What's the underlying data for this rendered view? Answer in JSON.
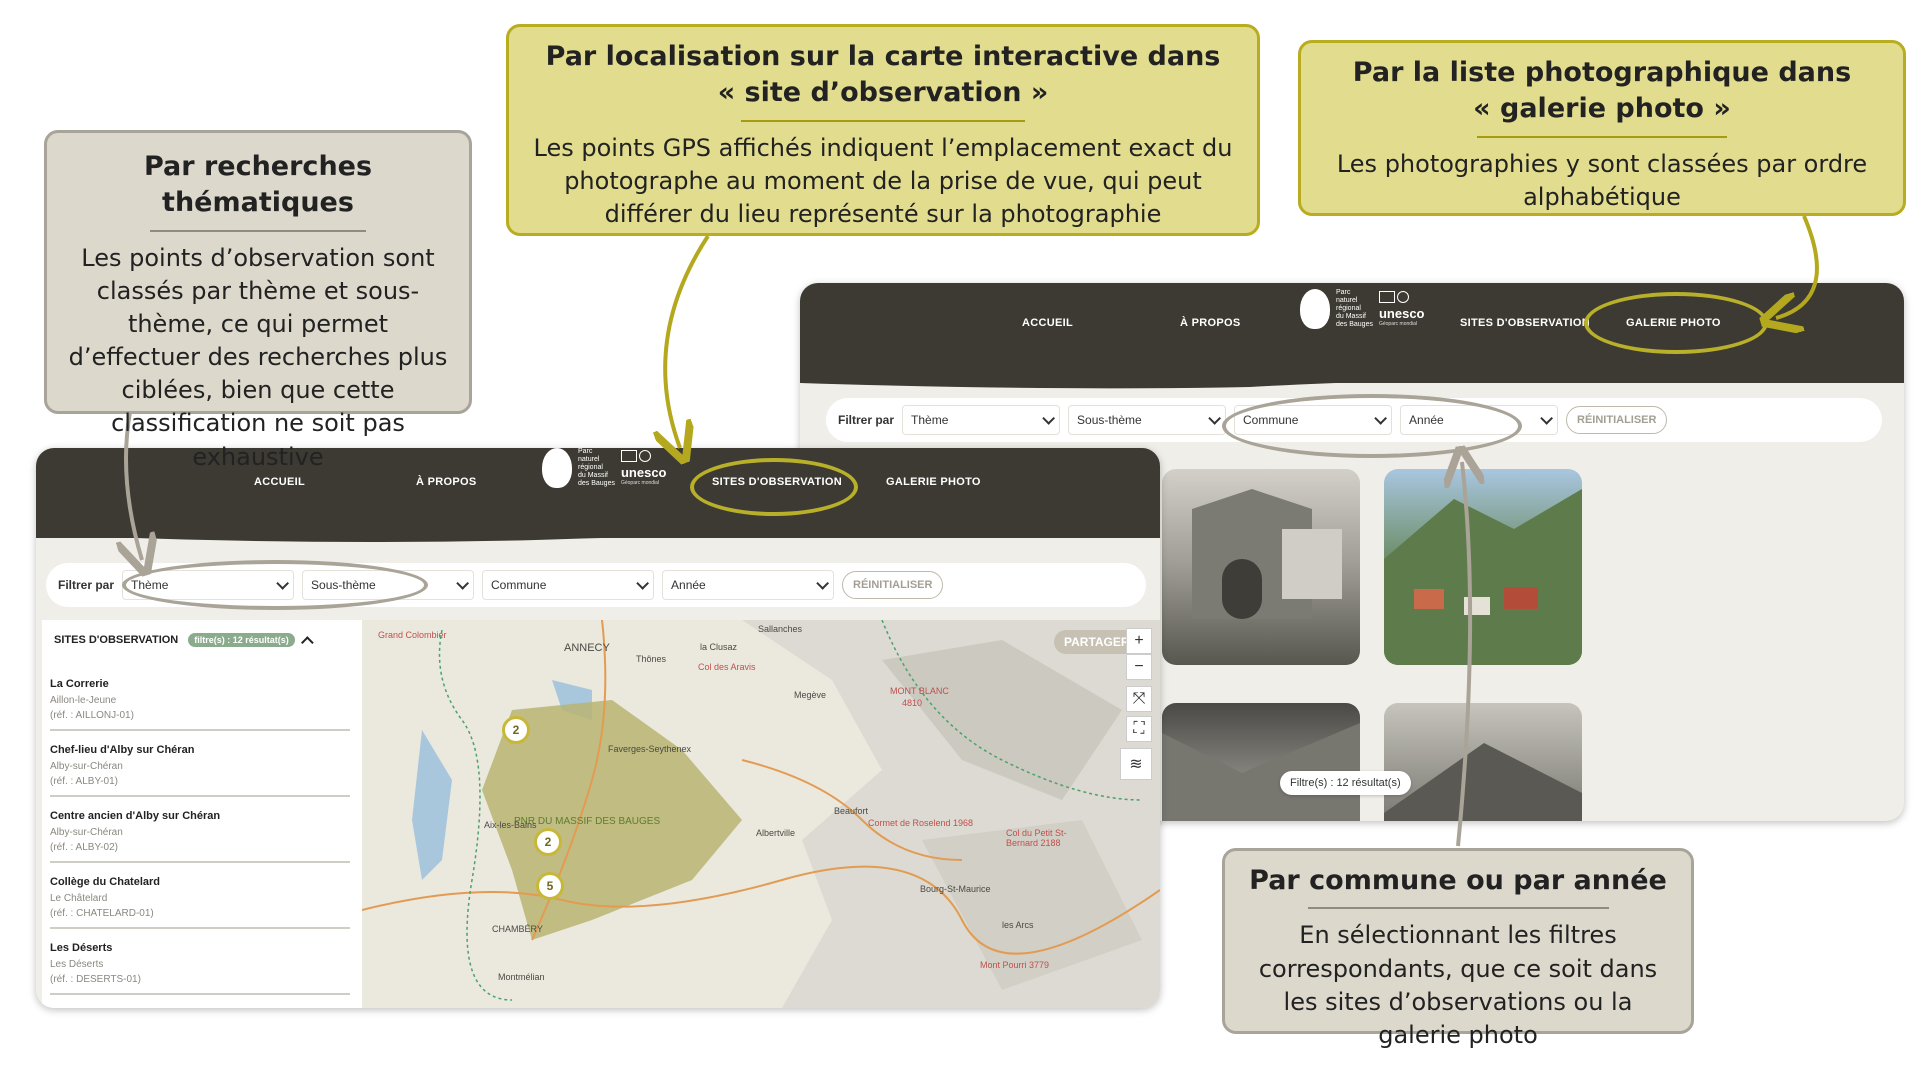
{
  "callouts": {
    "thematic": {
      "title": "Par recherches thématiques",
      "body": "Les points d’observation sont classés par thème et sous-thème, ce qui permet d’effectuer des recherches plus ciblées, bien que cette classification ne soit pas exhaustive"
    },
    "map": {
      "title_line1": "Par localisation sur la carte interactive dans",
      "title_line2": "« site d’observation »",
      "body": "Les points GPS affichés indiquent l’emplacement exact du photographe au moment de la prise de vue, qui peut différer du lieu représenté sur la photographie"
    },
    "gallery": {
      "title_line1": "Par la liste photographique dans",
      "title_line2": "« galerie photo »",
      "body": "Les photographies y sont classées par ordre alphabétique"
    },
    "commune": {
      "title": "Par commune ou par année",
      "body": "En sélectionnant les filtres correspondants, que ce soit dans les sites d’observations ou la galerie photo"
    }
  },
  "nav": {
    "home": "ACCUEIL",
    "about": "À PROPOS",
    "sites": "SITES D'OBSERVATION",
    "gallery": "GALERIE PHOTO"
  },
  "logo": {
    "park_lines": [
      "Parc",
      "naturel",
      "régional",
      "du Massif",
      "des Bauges"
    ],
    "unesco": "unesco",
    "geopark": "Géoparc mondial"
  },
  "filters_map": {
    "label": "Filtrer par",
    "theme": "Thème",
    "subtheme": "Sous-thème",
    "commune": "Commune",
    "year": "Année",
    "reset": "RÉINITIALISER"
  },
  "filters_gallery": {
    "label": "Filtrer par",
    "theme": "Thème",
    "subtheme": "Sous-thème",
    "commune": "Commune",
    "year": "Année",
    "reset": "RÉINITIALISER"
  },
  "sites_panel": {
    "title": "SITES D'OBSERVATION",
    "badge": "filtre(s) : 12 résultat(s)",
    "items": [
      {
        "name": "La Correrie",
        "commune": "Aillon-le-Jeune",
        "ref": "(réf. : AILLONJ-01)"
      },
      {
        "name": "Chef-lieu d'Alby sur Chéran",
        "commune": "Alby-sur-Chéran",
        "ref": "(réf. : ALBY-01)"
      },
      {
        "name": "Centre ancien d'Alby sur Chéran",
        "commune": "Alby-sur-Chéran",
        "ref": "(réf. : ALBY-02)"
      },
      {
        "name": "Collège du Chatelard",
        "commune": "Le Châtelard",
        "ref": "(réf. : CHATELARD-01)"
      },
      {
        "name": "Les Déserts",
        "commune": "Les Déserts",
        "ref": "(réf. : DESERTS-01)"
      }
    ]
  },
  "map": {
    "share": "PARTAGER",
    "zoom_in": "+",
    "zoom_out": "−",
    "clusters": [
      "2",
      "2",
      "5"
    ],
    "labels": {
      "grand_colombier": "Grand Colombier",
      "annecy": "ANNECY",
      "la_clusaz": "la Clusaz",
      "col_aravis": "Col des Aravis",
      "mont_blanc": "MONT BLANC",
      "mont_blanc_alt": "4810",
      "pnr": "PNR DU MASSIF DES BAUGES",
      "aix": "Aix-les-Bains",
      "chambery": "CHAMBÉRY",
      "albertville": "Albertville",
      "cormet": "Cormet de Roselend 1968",
      "petit_st_bernard": "Col du Petit St-Bernard 2188",
      "beaufort": "Beaufort",
      "bourg": "Bourg-St-Maurice",
      "megeve": "Megève",
      "sallanches": "Sallanches",
      "thones": "Thônes",
      "faverges": "Faverges-Seythenex",
      "montmelian": "Montmélian",
      "les_arcs": "les Arcs",
      "mont_pourri": "Mont Pourri 3779"
    }
  },
  "gallery": {
    "results": "Filtre(s) : 12 résultat(s)"
  },
  "colors": {
    "topbar": "#3d3a33",
    "accent_yellow": "#b9b02a",
    "accent_grey": "#a9a497",
    "badge_green": "#8bab8d"
  }
}
